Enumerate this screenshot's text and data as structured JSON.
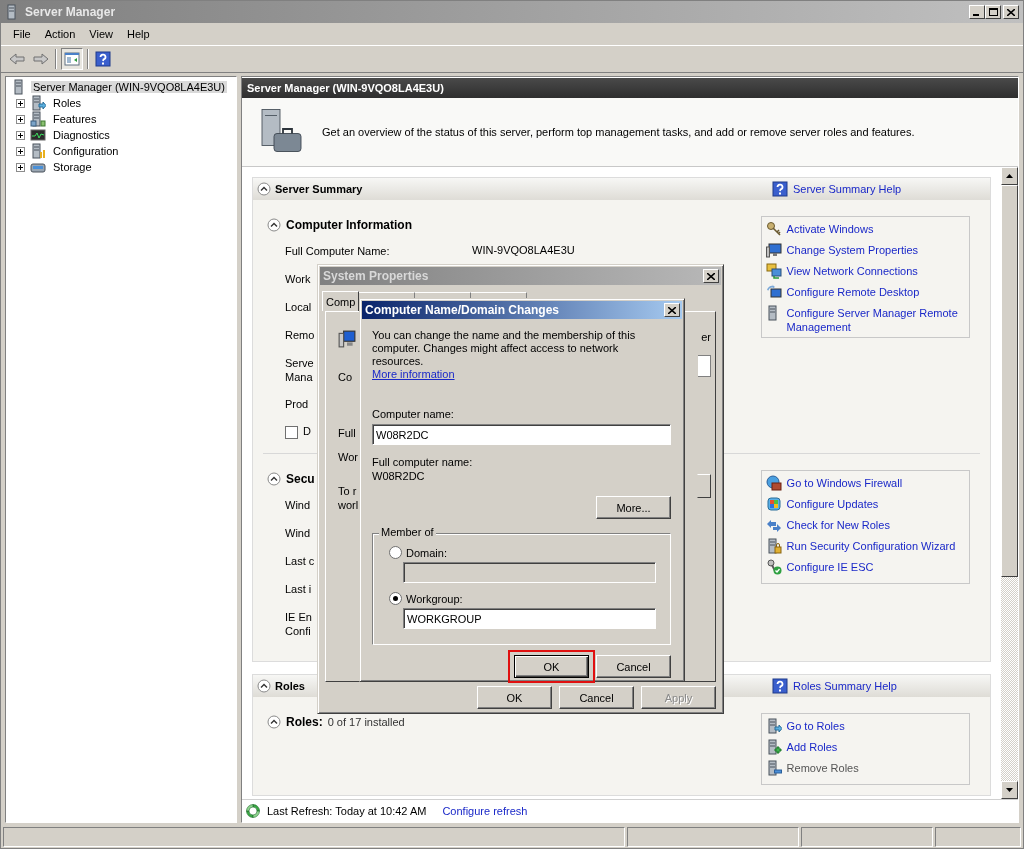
{
  "window": {
    "title": "Server Manager"
  },
  "menu": [
    {
      "label": "File"
    },
    {
      "label": "Action"
    },
    {
      "label": "View"
    },
    {
      "label": "Help"
    }
  ],
  "tree": {
    "label": "Server Manager (WIN-9VQO8LA4E3U)",
    "selected": true,
    "children": [
      {
        "label": "Roles",
        "expanded": false
      },
      {
        "label": "Features",
        "expanded": false
      },
      {
        "label": "Diagnostics",
        "expanded": false
      },
      {
        "label": "Configuration",
        "expanded": false
      },
      {
        "label": "Storage",
        "expanded": false
      }
    ]
  },
  "main": {
    "header": "Server Manager (WIN-9VQO8LA4E3U)",
    "description": "Get an overview of the status of this server, perform top management tasks, and add or remove server roles and features.",
    "sections": [
      {
        "title": "Server Summary",
        "expanded": true,
        "help": "Server Summary Help",
        "groups": [
          {
            "title": "Computer Information",
            "expanded": true,
            "rows": [
              {
                "kind": "field",
                "label": "Full Computer Name:",
                "value": "WIN-9VQO8LA4E3U"
              },
              {
                "kind": "field",
                "label": "Work"
              },
              {
                "kind": "field",
                "label": "Local"
              },
              {
                "kind": "field",
                "label": "Remo"
              },
              {
                "kind": "field",
                "label": "Serve\nMana"
              },
              {
                "kind": "field",
                "label": "Prod"
              },
              {
                "kind": "checkbox",
                "label": "D",
                "checked": false
              }
            ],
            "tasks": [
              {
                "label": "Activate Windows",
                "disabled": false
              },
              {
                "label": "Change System Properties",
                "disabled": false
              },
              {
                "label": "View Network Connections",
                "disabled": false
              },
              {
                "label": "Configure Remote Desktop",
                "disabled": false
              },
              {
                "label": "Configure Server Manager Remote Management",
                "disabled": false
              }
            ]
          },
          {
            "title": "Secu",
            "expanded": true,
            "rows": [
              {
                "kind": "field",
                "label": "Wind"
              },
              {
                "kind": "field",
                "label": "Wind"
              },
              {
                "kind": "field",
                "label": "Last c"
              },
              {
                "kind": "field",
                "label": "Last i"
              },
              {
                "kind": "field",
                "label": "IE En\nConfi"
              }
            ],
            "tasks": [
              {
                "label": "Go to Windows Firewall",
                "disabled": false
              },
              {
                "label": "Configure Updates",
                "disabled": false
              },
              {
                "label": "Check for New Roles",
                "disabled": false
              },
              {
                "label": "Run Security Configuration Wizard",
                "disabled": false
              },
              {
                "label": "Configure IE ESC",
                "disabled": false
              }
            ]
          }
        ]
      },
      {
        "title": "Roles",
        "expanded": true,
        "help": "Roles Summary Help",
        "groups": [
          {
            "title": "Roles:",
            "note": "0 of 17 installed",
            "expanded": true,
            "tasks": [
              {
                "label": "Go to Roles",
                "disabled": false
              },
              {
                "label": "Add Roles",
                "disabled": false
              },
              {
                "label": "Remove Roles",
                "disabled": true
              }
            ]
          }
        ]
      }
    ]
  },
  "refresh": {
    "text": "Last Refresh: Today at 10:42 AM",
    "link": "Configure refresh"
  },
  "system_properties": {
    "title": "System Properties",
    "active": false,
    "tab": "Comp",
    "fragments": [
      "Co",
      "Full",
      "Wor",
      "To r\nworl"
    ],
    "right_fragment": "er",
    "buttons": [
      {
        "label": "OK",
        "disabled": false
      },
      {
        "label": "Cancel",
        "disabled": false
      },
      {
        "label": "Apply",
        "disabled": true
      }
    ]
  },
  "name_dialog": {
    "title": "Computer Name/Domain Changes",
    "active": true,
    "intro": "You can change the name and the membership of this computer. Changes might affect access to network resources.",
    "link": "More information",
    "name_label": "Computer name:",
    "name_value": "W08R2DC",
    "full_label": "Full computer name:",
    "full_value": "W08R2DC",
    "more": "More...",
    "member_of": "Member of",
    "options": [
      {
        "label": "Domain:",
        "selected": false
      },
      {
        "label": "Workgroup:",
        "selected": true,
        "value": "WORKGROUP"
      }
    ],
    "buttons": [
      {
        "label": "OK",
        "highlighted": true,
        "default": true
      },
      {
        "label": "Cancel",
        "highlighted": false,
        "default": false
      }
    ]
  }
}
